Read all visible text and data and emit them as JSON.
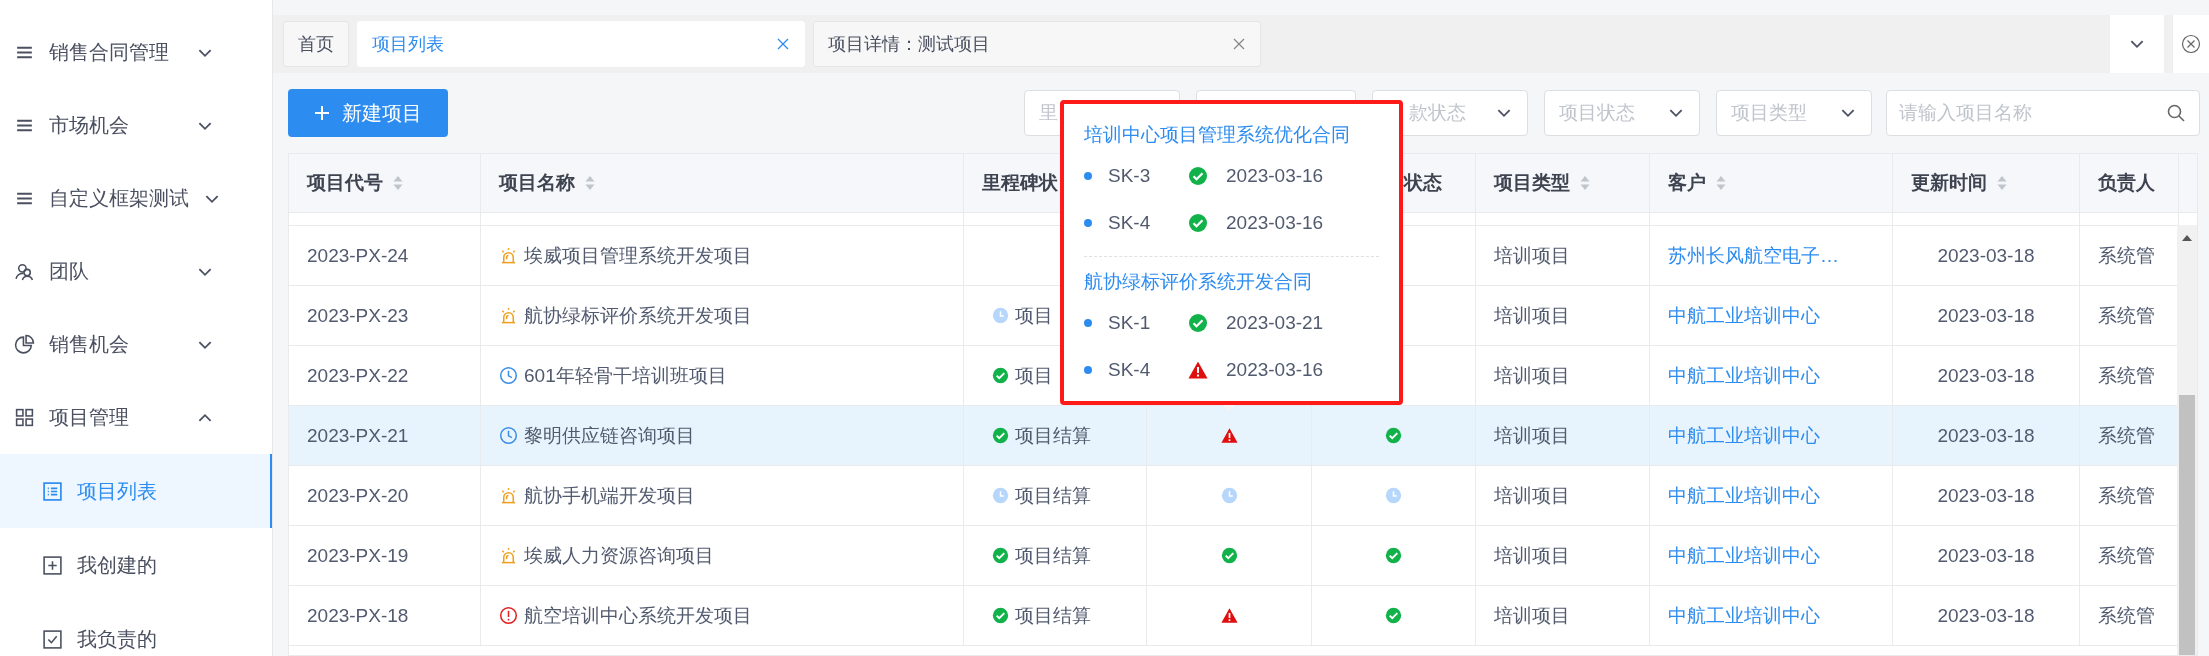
{
  "sidebar": {
    "items": [
      {
        "label": "销售合同管理",
        "kind": "menu",
        "expanded": false
      },
      {
        "label": "市场机会",
        "kind": "menu",
        "expanded": false
      },
      {
        "label": "自定义框架测试",
        "kind": "menu",
        "expanded": false
      },
      {
        "label": "团队",
        "kind": "team",
        "expanded": false
      },
      {
        "label": "销售机会",
        "kind": "pie",
        "expanded": false
      },
      {
        "label": "项目管理",
        "kind": "grid",
        "expanded": true,
        "children": [
          {
            "label": "项目列表",
            "kind": "list",
            "selected": true
          },
          {
            "label": "我创建的",
            "kind": "add",
            "selected": false
          },
          {
            "label": "我负责的",
            "kind": "check",
            "selected": false
          }
        ]
      }
    ]
  },
  "tabs": [
    {
      "label": "首页",
      "selected": false,
      "closable": false
    },
    {
      "label": "项目列表",
      "selected": true,
      "closable": true
    },
    {
      "label": "项目详情：测试项目",
      "selected": false,
      "closable": true
    }
  ],
  "toolbar": {
    "new_button": "新建项目",
    "filters": [
      {
        "placeholder": "里"
      },
      {
        "placeholder": "款状态"
      },
      {
        "placeholder": "项目状态"
      },
      {
        "placeholder": "项目类型"
      }
    ],
    "search": {
      "placeholder": "请输入项目名称"
    }
  },
  "table": {
    "columns": [
      {
        "label": "项目代号",
        "sortable": true
      },
      {
        "label": "项目名称",
        "sortable": true
      },
      {
        "label": "里程碑状",
        "sortable": false
      },
      {
        "label": "状态",
        "sortable": false
      },
      {
        "label": "项目类型",
        "sortable": true
      },
      {
        "label": "客户",
        "sortable": true
      },
      {
        "label": "更新时间",
        "sortable": true
      },
      {
        "label": "负责人",
        "sortable": false
      }
    ],
    "rows": [
      {
        "code": "2023-PX-24",
        "kind": "alarm",
        "name": "埃威项目管理系统开发项目",
        "type": "培训项目",
        "customer": "苏州长风航空电子…",
        "updated": "2023-03-18",
        "owner": "系统管",
        "selected": false
      },
      {
        "code": "2023-PX-23",
        "kind": "alarm",
        "name": "航协绿标评价系统开发项目",
        "milestone": {
          "kind": "pending",
          "label": "项目"
        },
        "type": "培训项目",
        "customer": "中航工业培训中心",
        "updated": "2023-03-18",
        "owner": "系统管",
        "selected": false
      },
      {
        "code": "2023-PX-22",
        "kind": "clock",
        "name": "601年轻骨干培训班项目",
        "milestone": {
          "kind": "done",
          "label": "项目"
        },
        "type": "培训项目",
        "customer": "中航工业培训中心",
        "updated": "2023-03-18",
        "owner": "系统管",
        "selected": false
      },
      {
        "code": "2023-PX-21",
        "kind": "clock",
        "name": "黎明供应链咨询项目",
        "milestone": {
          "kind": "done",
          "label": "项目结算"
        },
        "status_4": {
          "kind": "warning"
        },
        "status_5": {
          "kind": "done"
        },
        "type": "培训项目",
        "customer": "中航工业培训中心",
        "updated": "2023-03-18",
        "owner": "系统管",
        "selected": true
      },
      {
        "code": "2023-PX-20",
        "kind": "alarm",
        "name": "航协手机端开发项目",
        "milestone": {
          "kind": "pending",
          "label": "项目结算"
        },
        "status_4": {
          "kind": "pending"
        },
        "status_5": {
          "kind": "pending"
        },
        "type": "培训项目",
        "customer": "中航工业培训中心",
        "updated": "2023-03-18",
        "owner": "系统管",
        "selected": false
      },
      {
        "code": "2023-PX-19",
        "kind": "alarm",
        "name": "埃威人力资源咨询项目",
        "milestone": {
          "kind": "done",
          "label": "项目结算"
        },
        "status_4": {
          "kind": "done"
        },
        "status_5": {
          "kind": "done"
        },
        "type": "培训项目",
        "customer": "中航工业培训中心",
        "updated": "2023-03-18",
        "owner": "系统管",
        "selected": false
      },
      {
        "code": "2023-PX-18",
        "kind": "alert",
        "name": "航空培训中心系统开发项目",
        "milestone": {
          "kind": "done",
          "label": "项目结算"
        },
        "status_4": {
          "kind": "warning"
        },
        "status_5": {
          "kind": "done"
        },
        "type": "培训项目",
        "customer": "中航工业培训中心",
        "updated": "2023-03-18",
        "owner": "系统管",
        "selected": false
      }
    ]
  },
  "popup": {
    "groups": [
      {
        "title": "培训中心项目管理系统优化合同",
        "items": [
          {
            "code": "SK-3",
            "kind": "done",
            "date": "2023-03-16"
          },
          {
            "code": "SK-4",
            "kind": "done",
            "date": "2023-03-16"
          }
        ]
      },
      {
        "title": "航协绿标评价系统开发合同",
        "items": [
          {
            "code": "SK-1",
            "kind": "done",
            "date": "2023-03-21"
          },
          {
            "code": "SK-4",
            "kind": "warning",
            "date": "2023-03-16"
          }
        ]
      }
    ]
  }
}
